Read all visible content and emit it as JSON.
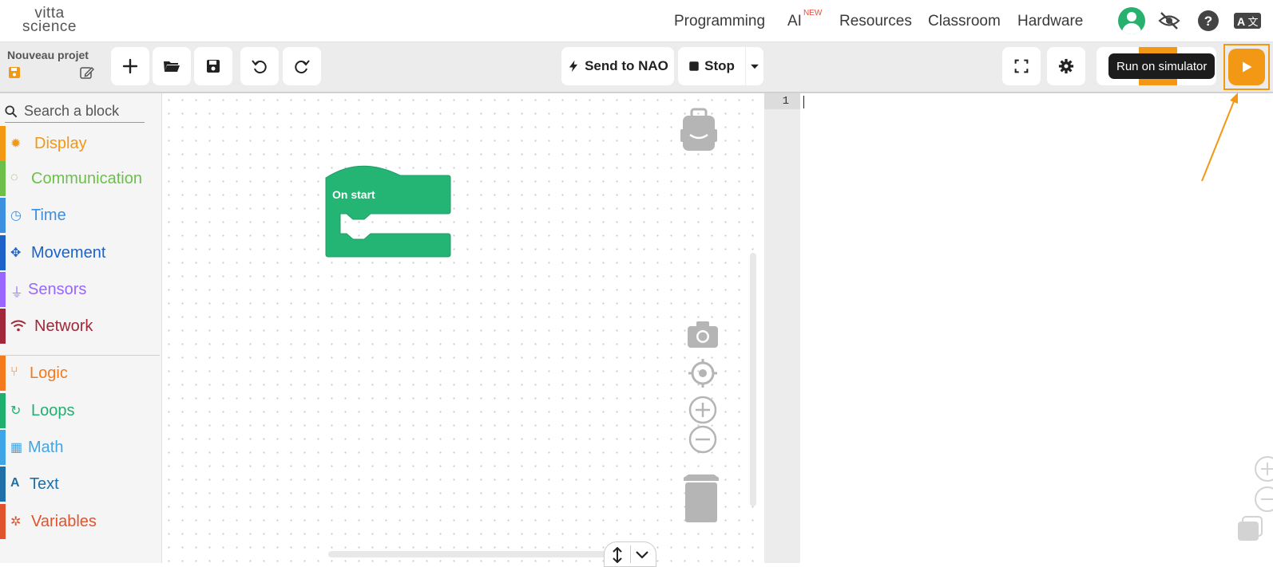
{
  "brand": {
    "logo_line1": "vitta",
    "logo_line2": "science"
  },
  "nav": {
    "programming": "Programming",
    "ai": "AI",
    "ai_badge": "NEW",
    "resources": "Resources",
    "classroom": "Classroom",
    "hardware": "Hardware"
  },
  "project": {
    "name": "Nouveau projet"
  },
  "toolbar": {
    "send_label": "Send to NAO",
    "stop_label": "Stop",
    "tooltip": "Run on simulator"
  },
  "search": {
    "placeholder": "Search a block"
  },
  "categories": [
    {
      "label": "Display",
      "color": "#f39814"
    },
    {
      "label": "Communication",
      "color": "#6cc04a"
    },
    {
      "label": "Time",
      "color": "#3d8fe0"
    },
    {
      "label": "Movement",
      "color": "#1c62c9"
    },
    {
      "label": "Sensors",
      "color": "#9966ff"
    },
    {
      "label": "Network",
      "color": "#a0283a"
    },
    {
      "label": "Logic",
      "color": "#f37a1d"
    },
    {
      "label": "Loops",
      "color": "#1fb070"
    },
    {
      "label": "Math",
      "color": "#3ea5e6"
    },
    {
      "label": "Text",
      "color": "#1f6fa8"
    },
    {
      "label": "Variables",
      "color": "#e0532c"
    }
  ],
  "workspace": {
    "block_label": "On start",
    "block_color": "#24b474"
  },
  "editor": {
    "line_number": "1"
  },
  "colors": {
    "accent": "#f39814",
    "dark_tooltip": "#1c1c1c"
  },
  "icons": [
    "plus-icon",
    "folder-icon",
    "save-icon",
    "undo-icon",
    "redo-icon",
    "bolt-icon",
    "stop-icon",
    "dropdown-icon",
    "fullscreen-icon",
    "gear-icon",
    "play-icon",
    "backpack-icon",
    "camera-icon",
    "target-icon",
    "zoom-in-icon",
    "zoom-out-icon",
    "trash-icon"
  ]
}
